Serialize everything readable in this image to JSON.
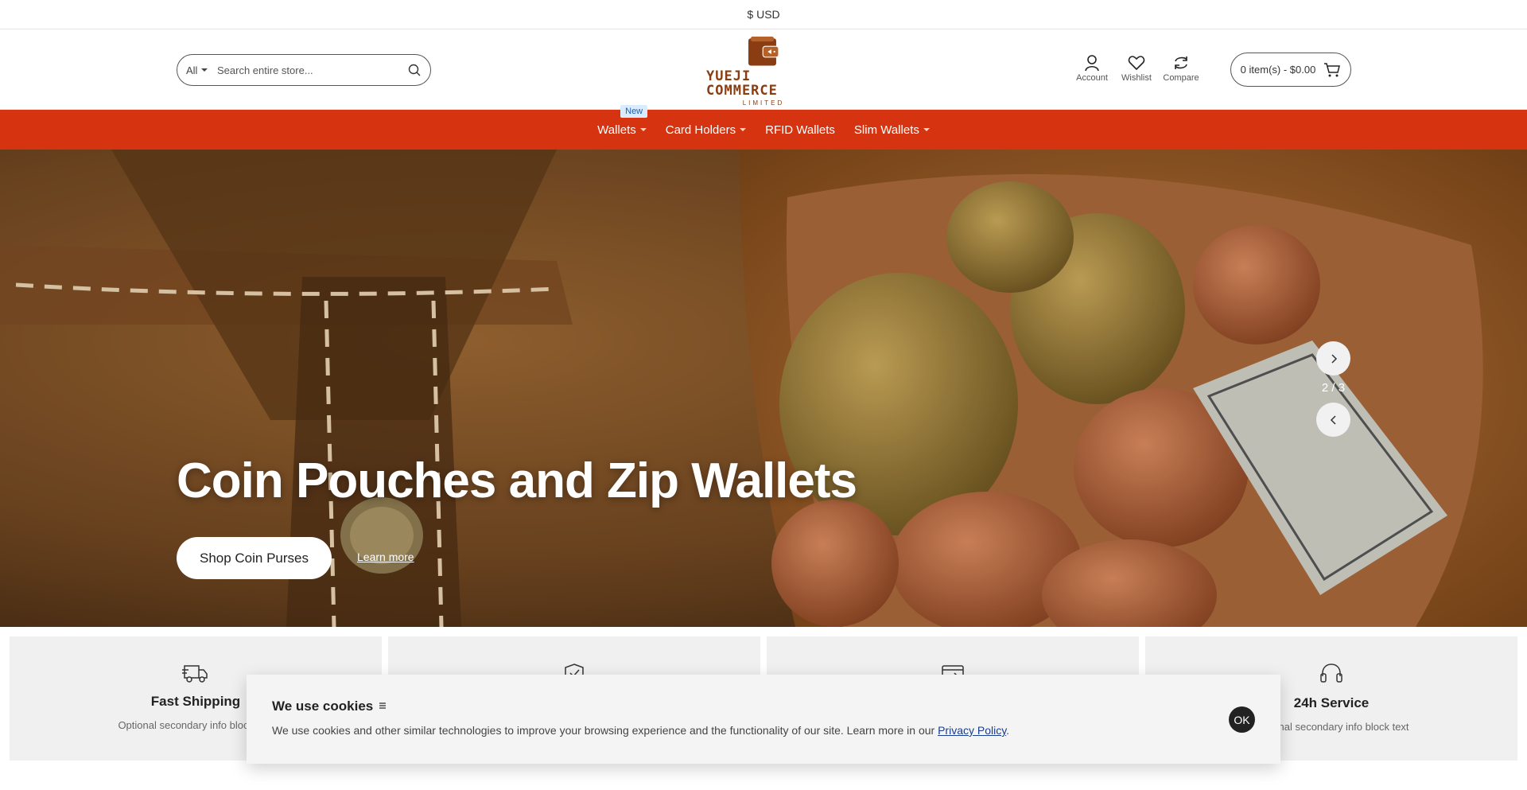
{
  "topbar": {
    "currency_symbol": "$",
    "currency": "USD"
  },
  "header": {
    "search": {
      "category": "All",
      "placeholder": "Search entire store..."
    },
    "logo": {
      "brand": "YUEJI COMMERCE",
      "subtitle": "LIMITED"
    },
    "icons": {
      "account_label": "Account",
      "wishlist_label": "Wishlist",
      "compare_label": "Compare"
    },
    "cart_label": "0 item(s) - $0.00"
  },
  "nav": {
    "items": [
      {
        "label": "Wallets",
        "badge": "New",
        "has_dropdown": true
      },
      {
        "label": "Card Holders",
        "has_dropdown": true
      },
      {
        "label": "RFID Wallets",
        "has_dropdown": false
      },
      {
        "label": "Slim Wallets",
        "has_dropdown": true
      }
    ]
  },
  "hero": {
    "title": "Coin Pouches and Zip Wallets",
    "button_label": "Shop Coin Purses",
    "link_label": "Learn more",
    "slide_counter": "2 / 3"
  },
  "info_blocks": [
    {
      "icon": "truck-icon",
      "title": "Fast Shipping",
      "text": "Optional secondary info block text"
    },
    {
      "icon": "shield-check-icon",
      "title": "",
      "text": ""
    },
    {
      "icon": "card-refresh-icon",
      "title": "",
      "text": ""
    },
    {
      "icon": "headset-icon",
      "title": "24h Service",
      "text": "Optional secondary info block text"
    }
  ],
  "cookie": {
    "title": "We use cookies",
    "text": "We use cookies and other similar technologies to improve your browsing experience and the functionality of our site. Learn more in our ",
    "policy_link": "Privacy Policy",
    "period": ".",
    "ok_label": "OK"
  },
  "colors": {
    "nav_bg": "#d63410",
    "brand": "#8a3d12",
    "badge_bg": "#d9ecff"
  }
}
